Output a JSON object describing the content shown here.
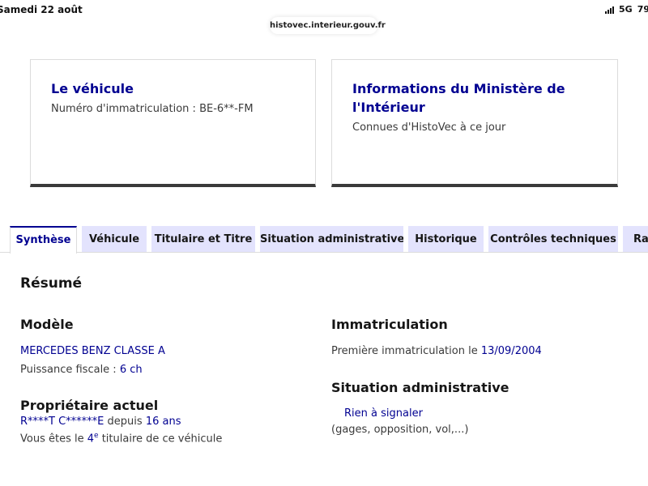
{
  "status_bar": {
    "date": "Samedi 22 août",
    "network": "5G",
    "battery": "79"
  },
  "browser": {
    "url": "histovec.interieur.gouv.fr"
  },
  "cards": {
    "vehicle": {
      "title": "Le véhicule",
      "plate_line": "Numéro d'immatriculation : BE-6**-FM"
    },
    "ministry": {
      "title_line1": "Informations du Ministère de",
      "title_line2": "l'Intérieur",
      "subtitle": "Connues d'HistoVec à ce jour"
    }
  },
  "tabs": [
    {
      "label": "Synthèse"
    },
    {
      "label": "Véhicule"
    },
    {
      "label": "Titulaire et Titre"
    },
    {
      "label": "Situation administrative"
    },
    {
      "label": "Historique"
    },
    {
      "label": "Contrôles techniques"
    },
    {
      "label": "Rap"
    }
  ],
  "summary": {
    "heading": "Résumé",
    "model": {
      "heading": "Modèle",
      "name": "MERCEDES BENZ CLASSE A",
      "power_label": "Puissance fiscale :",
      "power_value": "6 ch"
    },
    "owner": {
      "heading": "Propriétaire actuel",
      "name": "R****T C******E",
      "since_label": "depuis",
      "since_value": "16 ans",
      "rank_prefix": "Vous êtes le",
      "rank_value": "4",
      "rank_sup": "e",
      "rank_suffix": "titulaire de ce véhicule"
    },
    "registration": {
      "heading": "Immatriculation",
      "first_label": "Première immatriculation le",
      "first_date": "13/09/2004"
    },
    "admin": {
      "heading": "Situation administrative",
      "status": "Rien à signaler",
      "detail": "(gages, opposition, vol,...)"
    }
  },
  "colors": {
    "primary": "#000091",
    "tab_bg": "#e3e3fd",
    "text": "#3a3a3a"
  }
}
